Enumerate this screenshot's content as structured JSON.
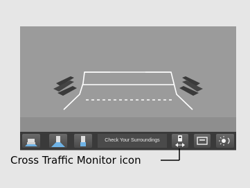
{
  "toolbar": {
    "message": "Check Your Surroundings",
    "buttons": [
      {
        "icon": "rear-view-normal-icon"
      },
      {
        "icon": "rear-view-wide-icon"
      },
      {
        "icon": "rear-view-top-down-icon"
      },
      {
        "icon": "cross-traffic-monitor-icon"
      },
      {
        "icon": "exit-icon"
      },
      {
        "icon": "brightness-icon"
      }
    ]
  },
  "callout": {
    "label": "Cross Traffic Monitor icon"
  },
  "colors": {
    "panel_bg": "#e6e6e6",
    "screen_bg": "#9b9b9b",
    "toolbar_bg": "#3a3a3a",
    "guide_lines": "#ffffff",
    "cross_traffic_arrows": "#3a3a3a"
  }
}
